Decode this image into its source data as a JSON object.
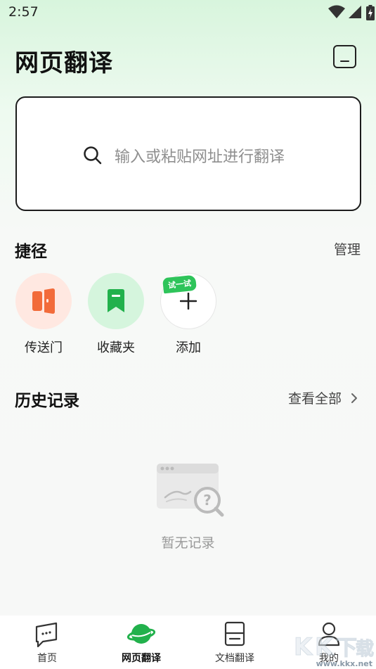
{
  "status_bar": {
    "time": "2:57"
  },
  "header": {
    "title": "网页翻译"
  },
  "search": {
    "placeholder": "输入或粘贴网址进行翻译"
  },
  "shortcuts": {
    "title": "捷径",
    "manage_label": "管理",
    "items": [
      {
        "label": "传送门",
        "icon": "portal-icon",
        "color": "#f26b3a"
      },
      {
        "label": "收藏夹",
        "icon": "bookmark-icon",
        "color": "#22b14c"
      },
      {
        "label": "添加",
        "icon": "plus-icon",
        "badge": "试一试"
      }
    ]
  },
  "history": {
    "title": "历史记录",
    "view_all_label": "查看全部",
    "empty_text": "暂无记录"
  },
  "bottom_nav": {
    "items": [
      {
        "label": "首页",
        "icon": "home-chat-icon"
      },
      {
        "label": "网页翻译",
        "icon": "planet-icon",
        "active": true
      },
      {
        "label": "文档翻译",
        "icon": "document-icon"
      },
      {
        "label": "我的",
        "icon": "user-icon"
      }
    ]
  },
  "watermark": {
    "text": "www.kkx.net"
  },
  "colors": {
    "accent": "#22b14c",
    "portal": "#f26b3a"
  }
}
